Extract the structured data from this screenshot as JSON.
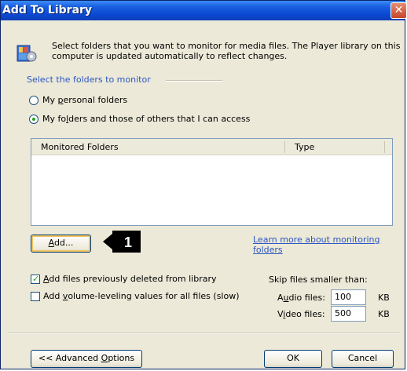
{
  "window": {
    "title": "Add To Library"
  },
  "intro": {
    "text": "Select folders that you want to monitor for media files. The Player library on this computer is updated automatically to reflect changes."
  },
  "monitor": {
    "section_label": "Select the folders to monitor",
    "option_personal": {
      "prefix": "My ",
      "accel": "p",
      "suffix": "ersonal folders",
      "checked": false
    },
    "option_others": {
      "prefix": "My fo",
      "accel": "l",
      "suffix": "ders and those of others that I can access",
      "checked": true
    }
  },
  "folders_table": {
    "columns": [
      "Monitored Folders",
      "Type"
    ],
    "rows": []
  },
  "buttons": {
    "add": {
      "accel": "A",
      "rest": "dd..."
    },
    "remove_faded": "",
    "advanced": {
      "prefix": "<< Advanced ",
      "accel": "O",
      "suffix": "ptions"
    },
    "ok": "OK",
    "cancel": "Cancel"
  },
  "callout_number": "1",
  "learn_more_link": "Learn more about monitoring folders",
  "options": {
    "add_deleted": {
      "prefix": "",
      "accel": "A",
      "suffix": "dd files previously deleted from library",
      "checked": true
    },
    "add_volume": {
      "prefix": "Add ",
      "accel": "v",
      "suffix": "olume-leveling values for all files (slow)",
      "checked": false
    }
  },
  "skip": {
    "label": "Skip files smaller than:",
    "audio": {
      "prefix": "A",
      "accel": "u",
      "suffix": "dio files:",
      "value": "100",
      "unit": "KB"
    },
    "video": {
      "prefix": "V",
      "accel": "i",
      "suffix": "deo files:",
      "value": "500",
      "unit": "KB"
    }
  },
  "colors": {
    "titlebar": "#0a48d2",
    "accent_link": "#2b56c4",
    "dialog_bg": "#ece9d8",
    "callout_bg": "#000000"
  }
}
